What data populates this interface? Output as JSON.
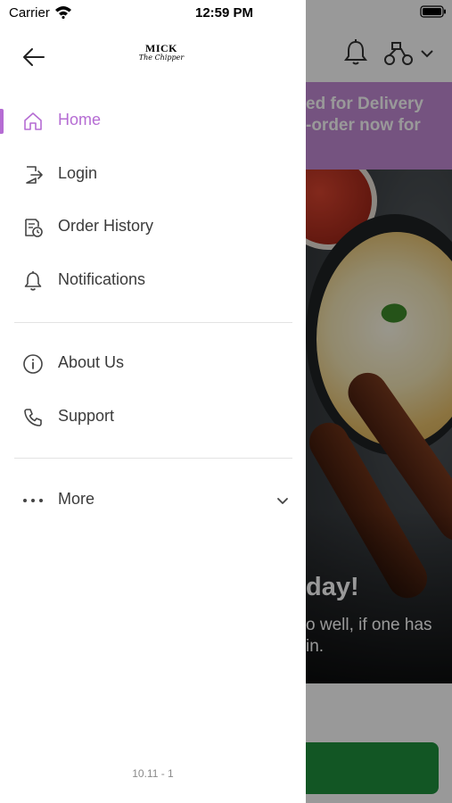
{
  "status_bar": {
    "carrier": "Carrier",
    "time": "12:59 PM"
  },
  "background": {
    "banner_line1": "ed for Delivery",
    "banner_line2": "-order now for",
    "banner_color": "#c48ad6",
    "hero_heading": "day!",
    "hero_line1": "o well, if one has",
    "hero_line2": "in."
  },
  "drawer": {
    "logo": {
      "name": "MICK",
      "tagline": "The Chipper"
    },
    "accent_color": "#b56cd3",
    "items": [
      {
        "label": "Home",
        "icon": "home-icon",
        "active": true
      },
      {
        "label": "Login",
        "icon": "login-icon",
        "active": false
      },
      {
        "label": "Order History",
        "icon": "order-history-icon",
        "active": false
      },
      {
        "label": "Notifications",
        "icon": "bell-icon",
        "active": false
      },
      {
        "label": "About Us",
        "icon": "info-icon",
        "active": false
      },
      {
        "label": "Support",
        "icon": "phone-icon",
        "active": false
      },
      {
        "label": "More",
        "icon": "more-dots-icon",
        "active": false
      }
    ],
    "version": "10.11 - 1"
  }
}
